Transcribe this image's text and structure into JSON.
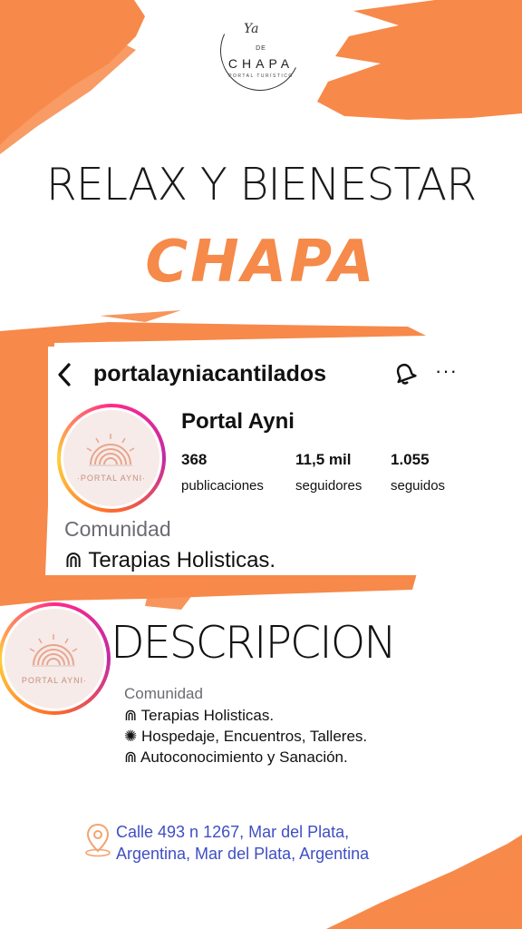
{
  "logo": {
    "script": "Ya",
    "de": "DE",
    "name": "CHAPA",
    "subtitle": "PORTAL TURÍSTICO"
  },
  "headline": "RELAX Y BIENESTAR",
  "brand": "CHAPA",
  "profile": {
    "back_icon": "chevron-left-icon",
    "username": "portalayniacantilados",
    "bell_icon": "bell-icon",
    "more_icon": "more-horizontal-icon",
    "more_label": "···",
    "avatar_text": "·PORTAL AYNI·",
    "display_name": "Portal Ayni",
    "stats": [
      {
        "value": "368",
        "label": "publicaciones"
      },
      {
        "value": "11,5 mil",
        "label": "seguidores"
      },
      {
        "value": "1.055",
        "label": "seguidos"
      }
    ],
    "category": "Comunidad",
    "bio_line": "⋒ Terapias Holisticas."
  },
  "description": {
    "heading": "DESCRIPCION",
    "avatar_text": "PORTAL AYNI·",
    "category": "Comunidad",
    "lines": [
      "⋒ Terapias Holisticas.",
      "✺ Hospedaje, Encuentros, Talleres.",
      "⋒ Autoconocimiento y Sanación."
    ]
  },
  "location": {
    "icon": "map-pin-icon",
    "line1": "Calle 493 n 1267, Mar del Plata,",
    "line2": "Argentina, Mar del Plata, Argentina"
  },
  "colors": {
    "accent": "#f58a4a",
    "link": "#3f4fc4"
  }
}
